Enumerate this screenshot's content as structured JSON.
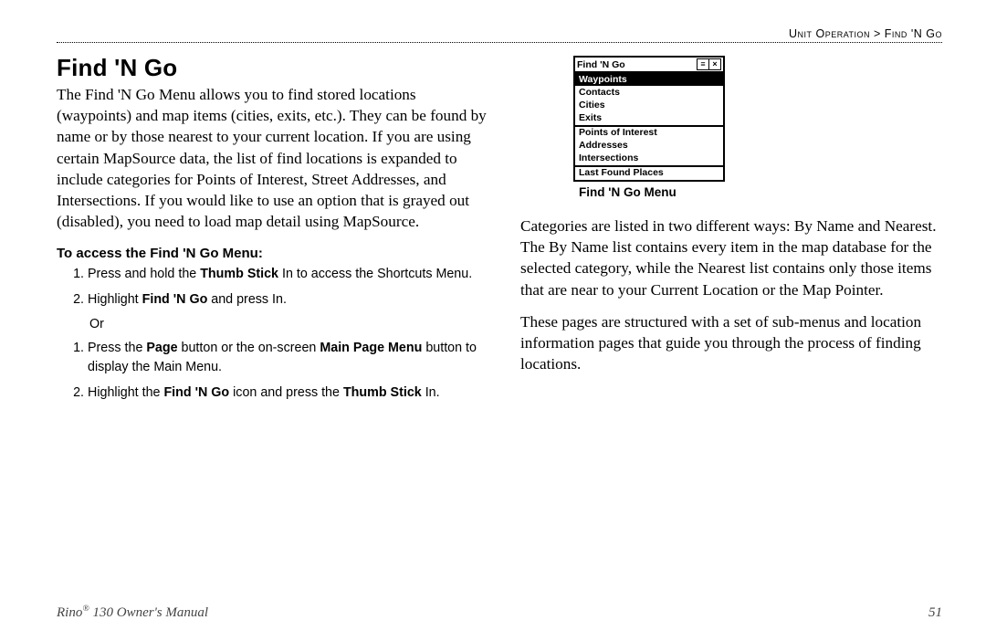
{
  "breadcrumb": "Unit Operation > Find 'N Go",
  "heading": "Find 'N Go",
  "intro": "The Find 'N Go Menu allows you to find stored locations (waypoints) and map items (cities, exits, etc.). They can be found by name or by those nearest to your current location. If you are using certain MapSource data, the list of find locations is expanded to include categories for Points of Interest, Street Addresses, and Intersections. If you would like to use an option that is grayed out (disabled), you need to load map detail using MapSource.",
  "subheading": "To access the Find 'N Go Menu:",
  "stepsA": {
    "s1a": "Press and hold the ",
    "s1b": "Thumb Stick",
    "s1c": " In to access the Shortcuts Menu.",
    "s2a": "Highlight ",
    "s2b": "Find 'N Go",
    "s2c": " and press In."
  },
  "or": "Or",
  "stepsB": {
    "s1a": "Press the ",
    "s1b": "Page",
    "s1c": " button or the on-screen ",
    "s1d": "Main Page Menu",
    "s1e": " button to display the Main Menu.",
    "s2a": "Highlight the ",
    "s2b": "Find 'N Go",
    "s2c": " icon and press the ",
    "s2d": "Thumb Stick",
    "s2e": " In."
  },
  "device": {
    "title": "Find 'N Go",
    "groups": [
      [
        "Waypoints",
        "Contacts",
        "Cities",
        "Exits"
      ],
      [
        "Points of Interest",
        "Addresses",
        "Intersections"
      ],
      [
        "Last Found Places"
      ]
    ],
    "selected": "Waypoints"
  },
  "caption": "Find 'N Go Menu",
  "para2": "Categories are listed in two different ways: By Name and Nearest. The By Name list contains every item in the map database for the selected category, while the Nearest list contains only those items that are near to your Current Location or the Map Pointer.",
  "para3": "These pages are structured with a set of sub-menus and location information pages that guide you through the process of finding locations.",
  "footer_left_a": "Rino",
  "footer_left_b": " 130 Owner's Manual",
  "page_number": "51"
}
